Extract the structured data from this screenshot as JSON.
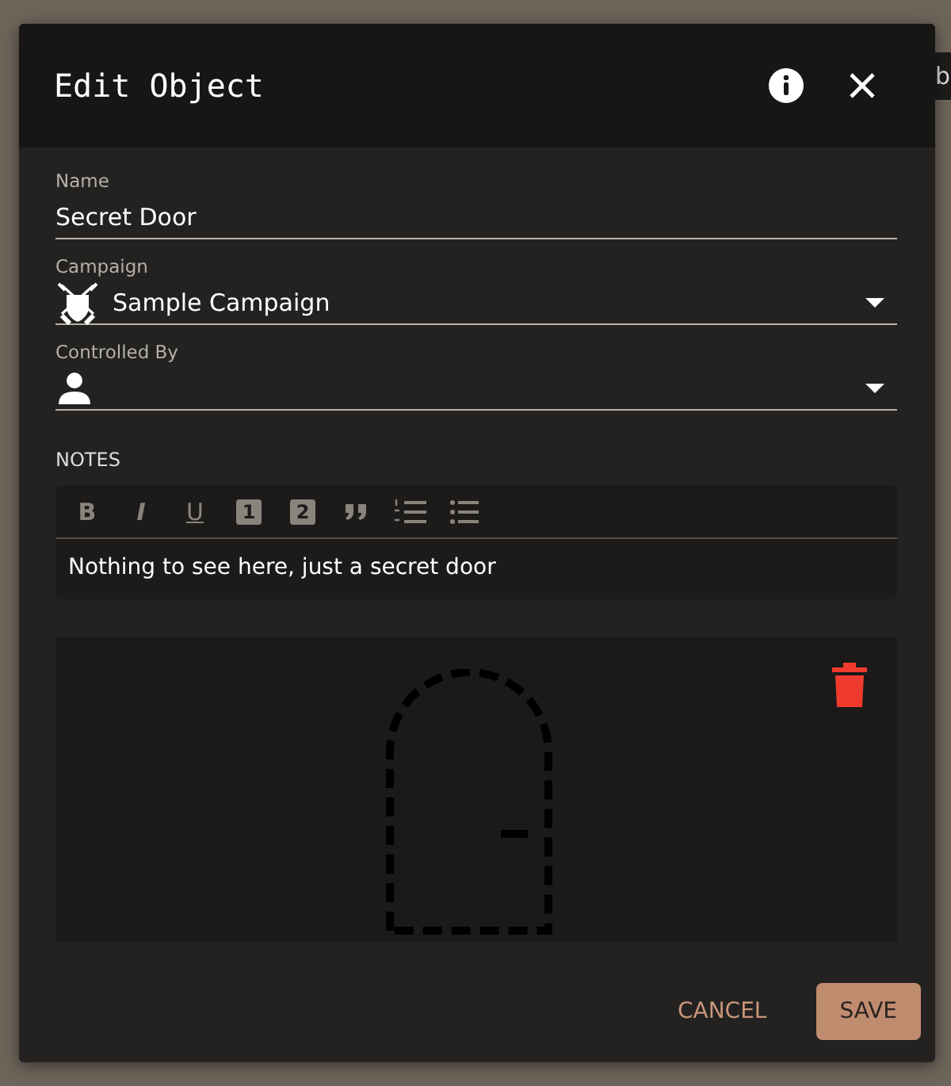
{
  "background": {
    "edge_label": "b"
  },
  "dialog": {
    "title": "Edit Object",
    "fields": [
      {
        "kind": "text",
        "label": "Name",
        "value": "Secret Door"
      },
      {
        "kind": "campaign-select",
        "label": "Campaign",
        "value": "Sample Campaign"
      },
      {
        "kind": "user-select",
        "label": "Controlled By"
      }
    ],
    "notes": {
      "label": "NOTES",
      "toolbar": [
        {
          "kind": "bold",
          "label": "B"
        },
        {
          "kind": "italic",
          "label": "I"
        },
        {
          "kind": "underline",
          "label": "U"
        },
        {
          "kind": "heading",
          "label": "1"
        },
        {
          "kind": "heading",
          "label": "2"
        },
        {
          "kind": "quote"
        },
        {
          "kind": "ordered-list"
        },
        {
          "kind": "bullet-list"
        }
      ],
      "text": "Nothing to see here, just a secret door"
    },
    "preview": {
      "kind": "door"
    },
    "buttons": [
      {
        "kind": "flat",
        "label": "CANCEL"
      },
      {
        "kind": "raised",
        "label": "SAVE"
      }
    ]
  }
}
